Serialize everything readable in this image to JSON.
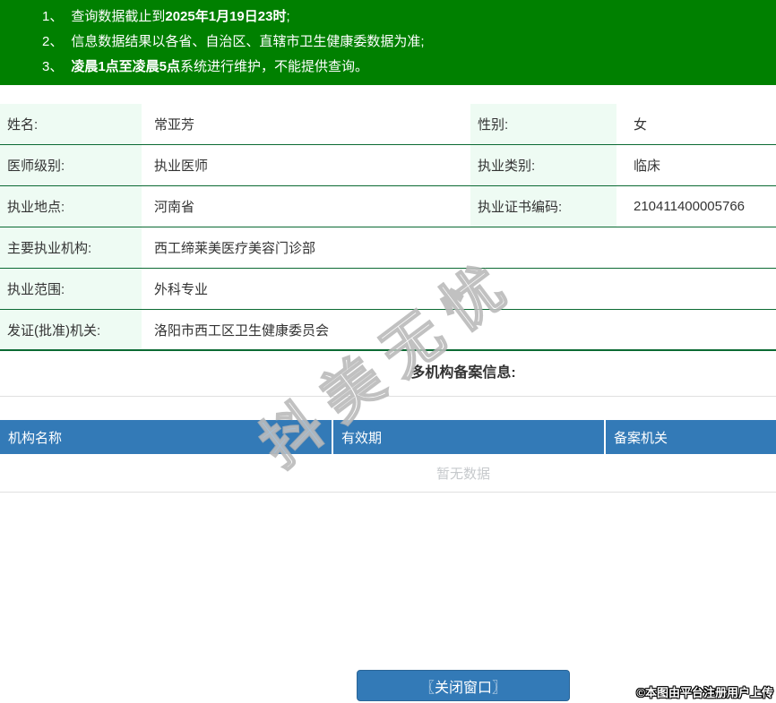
{
  "colors": {
    "banner_green": "#008000",
    "label_mint": "#eefbf3",
    "row_border_green": "#0b6a33",
    "header_blue": "#337ab7",
    "button_blue": "#337ab7",
    "button_border": "#2a6496",
    "light_border": "#e0e0e0",
    "empty_text": "#c6c9cc",
    "text": "#333333"
  },
  "banner": {
    "lines": [
      {
        "num": "1、",
        "pre": "查询数据截止到",
        "bold": "2025年1月19日23时",
        "post": ";"
      },
      {
        "num": "2、",
        "pre": "信息数据结果以各省、自治区、直辖市卫生健康委数据为准;",
        "bold": "",
        "post": ""
      },
      {
        "num": "3、",
        "pre": "",
        "bold": "凌晨1点至凌晨5点",
        "post": "系统进行维护，不能提供查询。"
      }
    ]
  },
  "info": {
    "rows": [
      {
        "label1": "姓名:",
        "value1": "常亚芳",
        "label2": "性别:",
        "value2": "女"
      },
      {
        "label1": "医师级别:",
        "value1": "执业医师",
        "label2": "执业类别:",
        "value2": "临床"
      },
      {
        "label1": "执业地点:",
        "value1": "河南省",
        "label2": "执业证书编码:",
        "value2": "210411400005766"
      },
      {
        "label1": "主要执业机构:",
        "value1": "西工缔莱美医疗美容门诊部"
      },
      {
        "label1": "执业范围:",
        "value1": "外科专业"
      },
      {
        "label1": "发证(批准)机关:",
        "value1": "洛阳市西工区卫生健康委员会"
      }
    ]
  },
  "section_title": "多机构备案信息:",
  "record": {
    "headers": [
      "机构名称",
      "有效期",
      "备案机关"
    ],
    "empty_text": "暂无数据"
  },
  "footer": {
    "close_label": "〖关闭窗口〗"
  },
  "watermark": {
    "text": "抖美无忧"
  },
  "copyright": {
    "text": "©本图由平台注册用户上传"
  }
}
